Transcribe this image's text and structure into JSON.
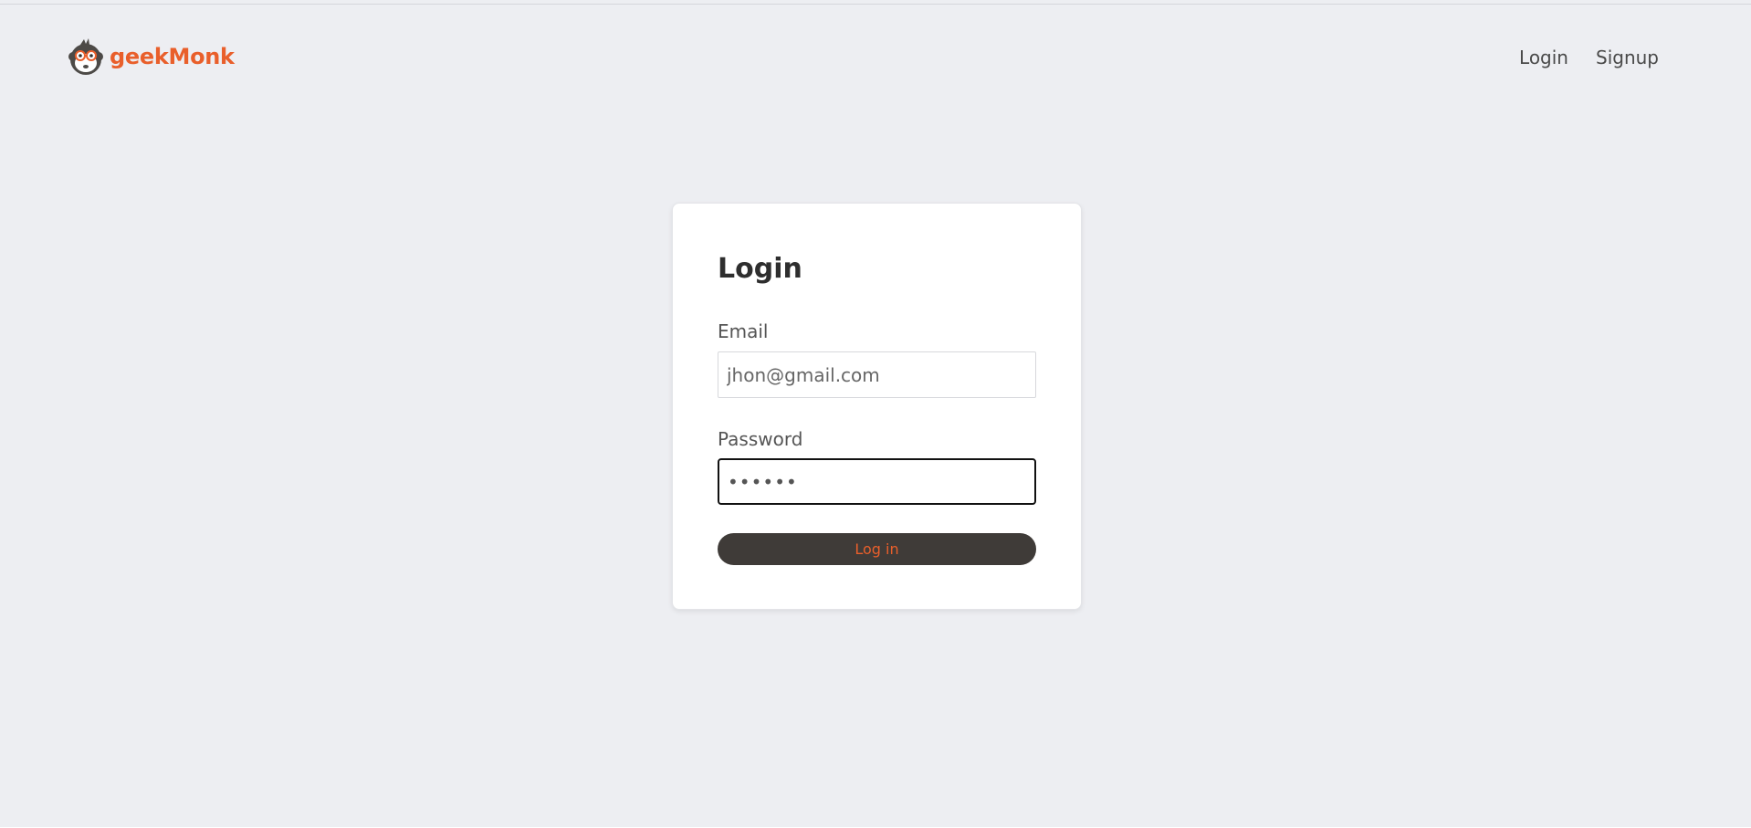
{
  "brand": {
    "name": "geekMonk",
    "logo_icon": "monkey-face-icon",
    "accent_color": "#e95f2b"
  },
  "nav": {
    "links": [
      {
        "label": "Login"
      },
      {
        "label": "Signup"
      }
    ]
  },
  "login_form": {
    "title": "Login",
    "email": {
      "label": "Email",
      "value": "jhon@gmail.com"
    },
    "password": {
      "label": "Password",
      "value": "••••••"
    },
    "submit_label": "Log in",
    "submit_bg_color": "#3f3b38"
  }
}
